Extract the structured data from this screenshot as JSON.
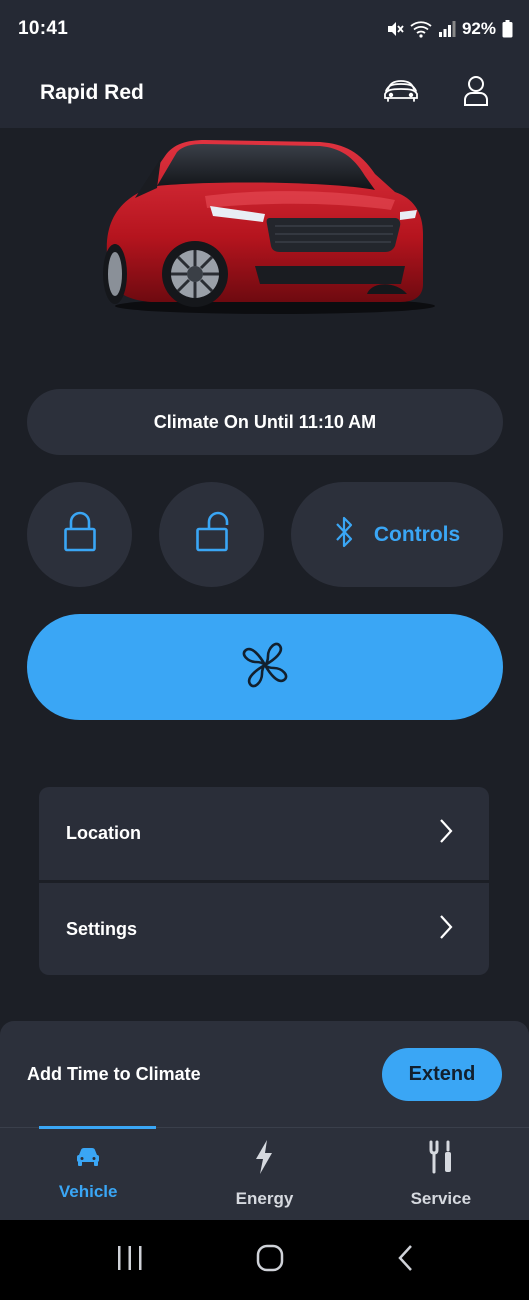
{
  "status_bar": {
    "time": "10:41",
    "battery": "92%"
  },
  "header": {
    "vehicle_name": "Rapid Red",
    "icons": [
      "vehicle-switch-icon",
      "account-icon"
    ]
  },
  "climate": {
    "status": "Climate On Until 11:10 AM"
  },
  "actions": {
    "lock_icon": "lock-icon",
    "unlock_icon": "unlock-icon",
    "controls_label": "Controls",
    "fan_icon": "fan-icon"
  },
  "menu": {
    "items": [
      {
        "label": "Location"
      },
      {
        "label": "Settings"
      }
    ]
  },
  "extend_panel": {
    "label": "Add Time to Climate",
    "button": "Extend"
  },
  "bottom_nav": {
    "items": [
      {
        "label": "Vehicle",
        "active": true
      },
      {
        "label": "Energy",
        "active": false
      },
      {
        "label": "Service",
        "active": false
      }
    ]
  },
  "colors": {
    "background": "#1c1f26",
    "surface": "#2c303b",
    "accent": "#3aa6f5",
    "car": "#c8202a"
  }
}
